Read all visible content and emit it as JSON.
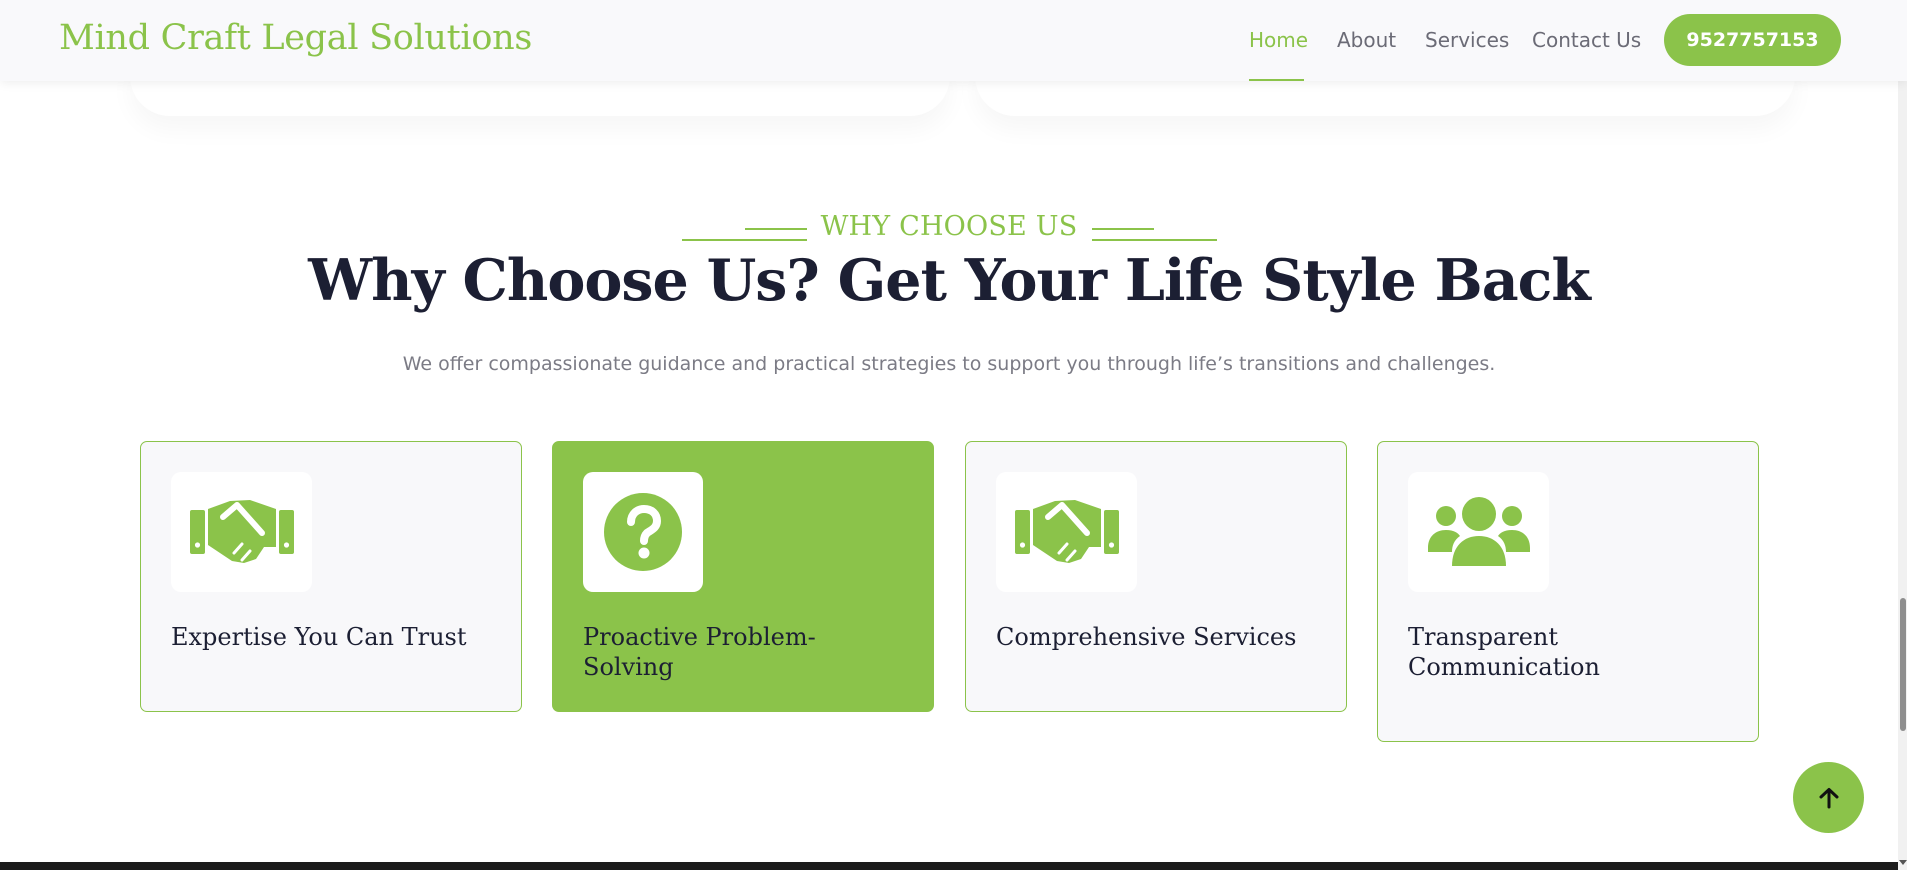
{
  "header": {
    "brand": "Mind Craft Legal Solutions",
    "nav": [
      {
        "label": "Home",
        "active": true
      },
      {
        "label": "About",
        "active": false
      },
      {
        "label": "Services",
        "active": false
      },
      {
        "label": "Contact Us",
        "active": false
      }
    ],
    "phone": "9527757153"
  },
  "section": {
    "eyebrow": "WHY CHOOSE US",
    "title": "Why Choose Us? Get Your Life Style Back",
    "subtitle": "We offer compassionate guidance and practical strategies to support you through life’s transitions and challenges."
  },
  "cards": [
    {
      "title": "Expertise You Can Trust",
      "icon": "handshake-icon",
      "highlighted": false
    },
    {
      "title": "Proactive Problem-Solving",
      "icon": "question-circle-icon",
      "highlighted": true
    },
    {
      "title": "Comprehensive Services",
      "icon": "handshake-icon",
      "highlighted": false
    },
    {
      "title": "Transparent Communication",
      "icon": "users-icon",
      "highlighted": false
    }
  ],
  "back_to_top": {
    "icon": "arrow-up-icon"
  },
  "colors": {
    "accent": "#8bc34a",
    "heading": "#1c1f33",
    "body_text": "#7b7b85",
    "card_bg": "#f8f8fa",
    "header_bg": "#f9f9fb"
  }
}
